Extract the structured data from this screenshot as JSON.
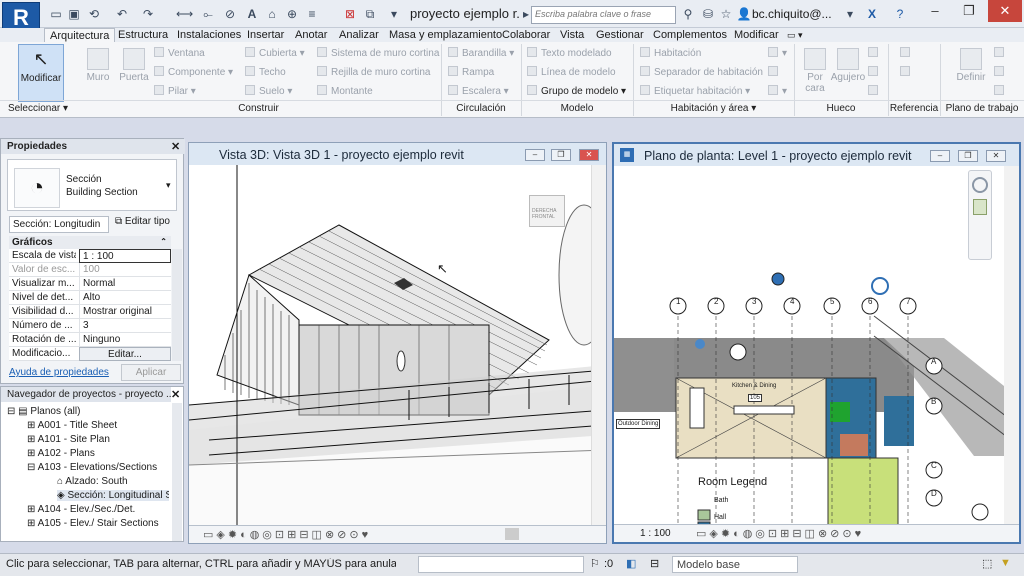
{
  "app": {
    "logo": "R",
    "doc_title": "proyecto ejemplo r...",
    "search_placeholder": "Escriba palabra clave o frase",
    "user": "bc.chiquito@...",
    "help": "?"
  },
  "tabs": [
    "Arquitectura",
    "Estructura",
    "Instalaciones",
    "Insertar",
    "Anotar",
    "Analizar",
    "Masa y emplazamiento",
    "Colaborar",
    "Vista",
    "Gestionar",
    "Complementos",
    "Modificar"
  ],
  "ribbon": {
    "modificar": "Modificar",
    "muro": "Muro",
    "puerta": "Puerta",
    "construir_col1": [
      "Ventana",
      "Componente",
      "Pilar"
    ],
    "construir_col2": [
      "Cubierta",
      "Techo",
      "Suelo"
    ],
    "construir_col3": [
      "Sistema de muro cortina",
      "Rejilla de muro cortina",
      "Montante"
    ],
    "circulacion": [
      "Barandilla",
      "Rampa",
      "Escalera"
    ],
    "modelo": [
      "Texto modelado",
      "Línea de modelo",
      "Grupo de modelo"
    ],
    "habitacion": [
      "Habitación",
      "Separador de habitación",
      "Etiquetar habitación"
    ],
    "por_cara": "Por cara",
    "agujero": "Agujero",
    "definir": "Definir",
    "panels": [
      "Seleccionar",
      "Construir",
      "Circulación",
      "Modelo",
      "Habitación y área",
      "Hueco",
      "Referencia",
      "Plano de trabajo"
    ]
  },
  "properties": {
    "title": "Propiedades",
    "type_line1": "Sección",
    "type_line2": "Building Section",
    "instance_filter": "Sección: Longitudin",
    "edit_type": "Editar tipo",
    "group": "Gráficos",
    "rows": [
      {
        "k": "Escala de vista",
        "v": "1 : 100"
      },
      {
        "k": "Valor de esc...",
        "v": "100"
      },
      {
        "k": "Visualizar m...",
        "v": "Normal"
      },
      {
        "k": "Nivel de det...",
        "v": "Alto"
      },
      {
        "k": "Visibilidad d...",
        "v": "Mostrar original"
      },
      {
        "k": "Número de ...",
        "v": "3"
      },
      {
        "k": "Rotación de ...",
        "v": "Ninguno"
      },
      {
        "k": "Modificacio...",
        "v": "Editar..."
      }
    ],
    "help_link": "Ayuda de propiedades",
    "apply": "Aplicar"
  },
  "browser": {
    "title": "Navegador de proyectos - proyecto ...",
    "items": [
      "Planos (all)",
      "A001 - Title Sheet",
      "A101 - Site Plan",
      "A102 - Plans",
      "A103 - Elevations/Sections",
      "Alzado: South",
      "Sección: Longitudinal S",
      "A104 - Elev./Sec./Det.",
      "A105 - Elev./ Stair Sections"
    ]
  },
  "view3d": {
    "title": "Vista 3D: Vista 3D 1 - proyecto ejemplo revit",
    "cube_left": "DERECHA",
    "cube_right": "FRONTAL"
  },
  "plan": {
    "title": "Plano de planta: Level 1 - proyecto ejemplo revit",
    "scale": "1 : 100",
    "room_legend": "Room Legend",
    "legend": [
      {
        "label": "Bath",
        "color": "#a8c79a"
      },
      {
        "label": "Hall",
        "color": "#2f6f9a"
      }
    ],
    "grid_top": [
      "1",
      "2",
      "3",
      "4",
      "5",
      "6",
      "7"
    ],
    "grid_right": [
      "A",
      "B",
      "C",
      "D"
    ],
    "kitchen": "Kitchen & Dining",
    "outdoor": "Outdoor Dining",
    "room_tag": "105"
  },
  "status": {
    "hint": "Clic para seleccionar, TAB para alternar, CTRL para añadir y MAYÚS para anular una selecció",
    "count": ":0",
    "model": "Modelo base"
  }
}
